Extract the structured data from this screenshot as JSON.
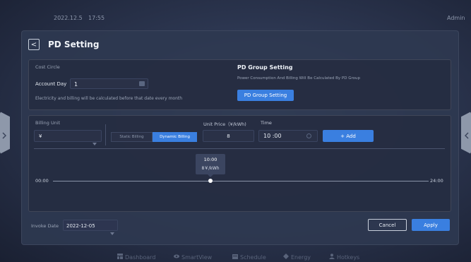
{
  "topbar": {
    "date": "2022.12.5",
    "time": "17:55",
    "user": "Admin"
  },
  "page": {
    "title": "PD Setting"
  },
  "cost_circle": {
    "heading": "Cost Circle",
    "account_day_label": "Account Day",
    "account_day_value": "1",
    "note": "Electricity and billing will be calculated before that date every month"
  },
  "pd_group": {
    "heading": "PD Group Setting",
    "description": "Power Consumption And Billing Will Be Calculated By PD Group",
    "button_label": "PD Group Setting"
  },
  "billing": {
    "billing_unit_label": "Billing Unit",
    "billing_unit_value": "¥",
    "static_label": "Static Billing",
    "dynamic_label": "Dynamic Billing",
    "active_mode": "Dynamic Billing",
    "unit_price_label": "Unit Price（¥/kWh)",
    "unit_price_value": "8",
    "time_label": "Time",
    "time_value": "10 :00",
    "add_label": "+ Add"
  },
  "timeline": {
    "start": "00:00",
    "end": "24:00",
    "marker_time": "10:00",
    "marker_price": "8￥/kWh",
    "marker_hour": 10
  },
  "footer": {
    "invoke_date_label": "Invoke Date",
    "invoke_date_value": "2022-12-05",
    "cancel_label": "Cancel",
    "apply_label": "Apply"
  },
  "nav": {
    "items": [
      {
        "label": "Dashboard",
        "icon": "dashboard-icon"
      },
      {
        "label": "SmartView",
        "icon": "eye-icon"
      },
      {
        "label": "Schedule",
        "icon": "calendar-icon"
      },
      {
        "label": "Energy",
        "icon": "diamond-icon"
      },
      {
        "label": "Hotkeys",
        "icon": "person-icon"
      }
    ]
  },
  "colors": {
    "accent": "#3a7fe0",
    "panel": "#2e3850",
    "text": "#e6ebf2"
  }
}
